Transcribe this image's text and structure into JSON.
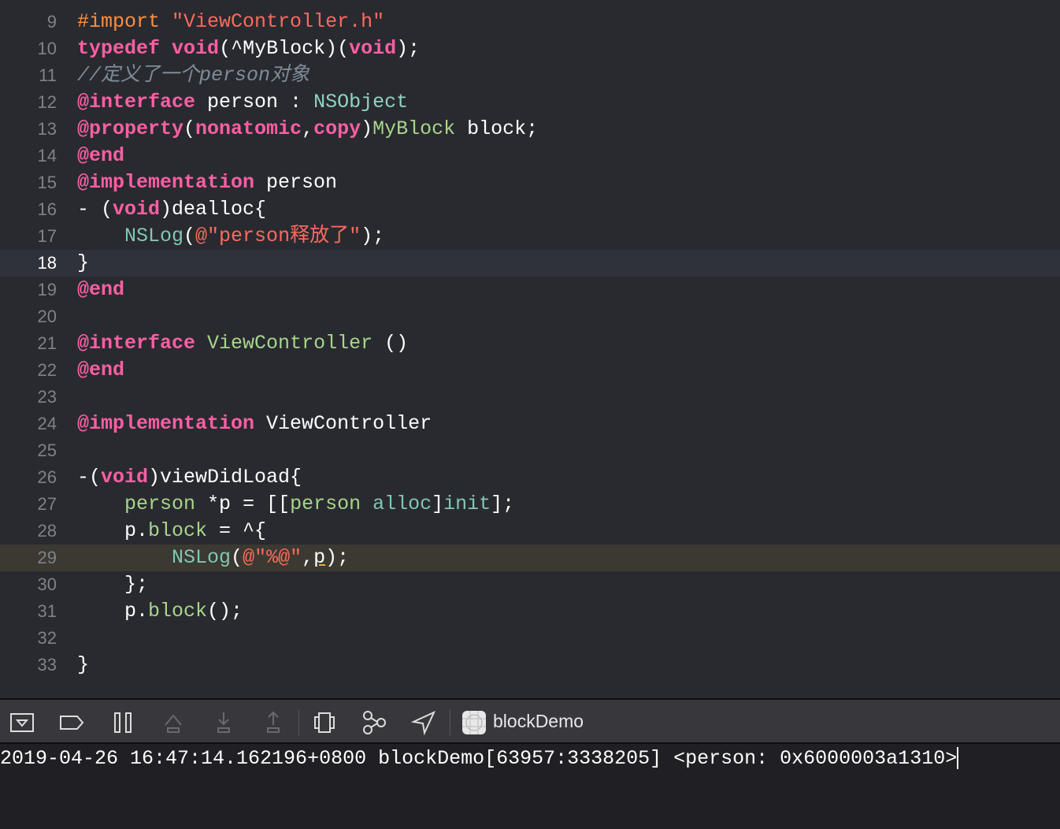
{
  "editor": {
    "current_line": 18,
    "highlighted_line": 29,
    "lines": [
      {
        "n": "9",
        "t": [
          [
            "#import ",
            "pre"
          ],
          [
            "\"ViewController.h\"",
            "str"
          ]
        ]
      },
      {
        "n": "10",
        "t": [
          [
            "typedef",
            "kw"
          ],
          [
            " ",
            "pl"
          ],
          [
            "void",
            "kw"
          ],
          [
            "(^MyBlock)(",
            "pl"
          ],
          [
            "void",
            "kw"
          ],
          [
            ");",
            "pl"
          ]
        ]
      },
      {
        "n": "11",
        "t": [
          [
            "//定义了一个person对象",
            "cm"
          ]
        ]
      },
      {
        "n": "12",
        "t": [
          [
            "@interface",
            "kw"
          ],
          [
            " person : ",
            "pl"
          ],
          [
            "NSObject",
            "cls"
          ]
        ]
      },
      {
        "n": "13",
        "t": [
          [
            "@property",
            "kw"
          ],
          [
            "(",
            "pl"
          ],
          [
            "nonatomic",
            "kw"
          ],
          [
            ",",
            "pl"
          ],
          [
            "copy",
            "kw"
          ],
          [
            ")",
            "pl"
          ],
          [
            "MyBlock",
            "proj"
          ],
          [
            " block;",
            "pl"
          ]
        ]
      },
      {
        "n": "14",
        "t": [
          [
            "@end",
            "kw"
          ]
        ]
      },
      {
        "n": "15",
        "t": [
          [
            "@implementation",
            "kw"
          ],
          [
            " person",
            "pl"
          ]
        ]
      },
      {
        "n": "16",
        "t": [
          [
            "- (",
            "pl"
          ],
          [
            "void",
            "kw"
          ],
          [
            ")dealloc{",
            "pl"
          ]
        ]
      },
      {
        "n": "17",
        "t": [
          [
            "    ",
            "pl"
          ],
          [
            "NSLog",
            "fn"
          ],
          [
            "(",
            "pl"
          ],
          [
            "@\"person释放了\"",
            "str"
          ],
          [
            ");",
            "pl"
          ]
        ]
      },
      {
        "n": "18",
        "t": [
          [
            "}",
            "pl"
          ]
        ]
      },
      {
        "n": "19",
        "t": [
          [
            "@end",
            "kw"
          ]
        ]
      },
      {
        "n": "20",
        "t": []
      },
      {
        "n": "21",
        "t": [
          [
            "@interface",
            "kw"
          ],
          [
            " ",
            "pl"
          ],
          [
            "ViewController",
            "proj"
          ],
          [
            " ()",
            "pl"
          ]
        ]
      },
      {
        "n": "22",
        "t": [
          [
            "@end",
            "kw"
          ]
        ]
      },
      {
        "n": "23",
        "t": []
      },
      {
        "n": "24",
        "t": [
          [
            "@implementation",
            "kw"
          ],
          [
            " ViewController",
            "pl"
          ]
        ]
      },
      {
        "n": "25",
        "t": []
      },
      {
        "n": "26",
        "t": [
          [
            "-(",
            "pl"
          ],
          [
            "void",
            "kw"
          ],
          [
            ")viewDidLoad{",
            "pl"
          ]
        ]
      },
      {
        "n": "27",
        "t": [
          [
            "    ",
            "pl"
          ],
          [
            "person",
            "proj"
          ],
          [
            " *p = [[",
            "pl"
          ],
          [
            "person",
            "proj"
          ],
          [
            " ",
            "pl"
          ],
          [
            "alloc",
            "fn"
          ],
          [
            "]",
            "pl"
          ],
          [
            "init",
            "fn"
          ],
          [
            "];",
            "pl"
          ]
        ]
      },
      {
        "n": "28",
        "t": [
          [
            "    p.",
            "pl"
          ],
          [
            "block",
            "proj"
          ],
          [
            " = ^{",
            "pl"
          ]
        ]
      },
      {
        "n": "29",
        "t": [
          [
            "        ",
            "pl"
          ],
          [
            "NSLog",
            "fn"
          ],
          [
            "(",
            "pl"
          ],
          [
            "@\"%@\"",
            "str"
          ],
          [
            ",",
            "pl"
          ],
          [
            "p",
            "ul"
          ],
          [
            ");",
            "pl"
          ]
        ]
      },
      {
        "n": "30",
        "t": [
          [
            "    };",
            "pl"
          ]
        ]
      },
      {
        "n": "31",
        "t": [
          [
            "    p.",
            "pl"
          ],
          [
            "block",
            "proj"
          ],
          [
            "();",
            "pl"
          ]
        ]
      },
      {
        "n": "32",
        "t": []
      },
      {
        "n": "33",
        "t": [
          [
            "}",
            "pl"
          ]
        ]
      }
    ]
  },
  "toolbar": {
    "buttons": [
      "hide-debug-area",
      "breakpoints-toggle",
      "pause",
      "step-over",
      "step-into",
      "step-out",
      "view-debugger",
      "memory-graph",
      "simulate-location"
    ],
    "app_name": "blockDemo"
  },
  "console": {
    "output": "2019-04-26 16:47:14.162196+0800 blockDemo[63957:3338205] <person: 0x6000003a1310>"
  }
}
